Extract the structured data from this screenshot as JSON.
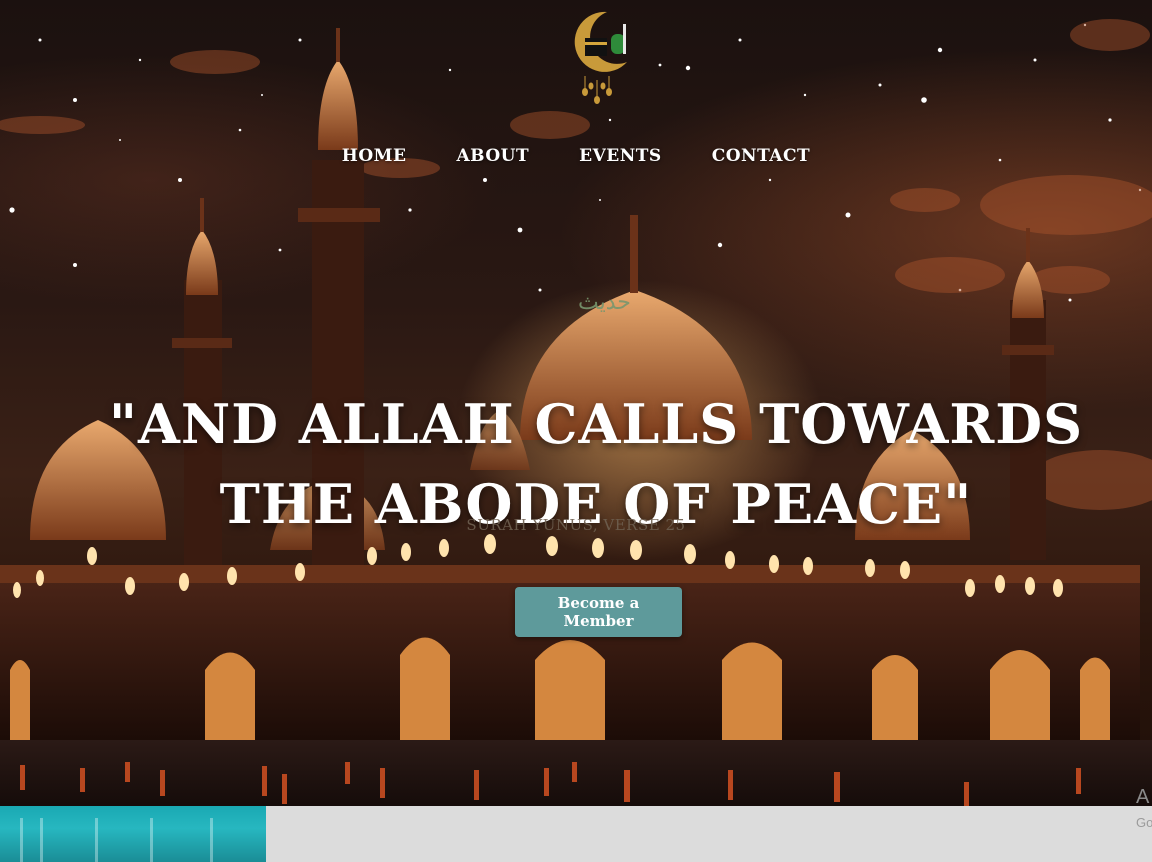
{
  "nav": {
    "items": [
      {
        "label": "Home"
      },
      {
        "label": "About"
      },
      {
        "label": "Events"
      },
      {
        "label": "Contact"
      }
    ]
  },
  "hero": {
    "quote": "\"And Allah calls towards the Abode of Peace\"",
    "citation": "Surah Yunus, Verse 25",
    "cta_label": "Become a Member",
    "arabic_mark": "حديث"
  },
  "colors": {
    "cta_background": "#5e9a9b",
    "teal_strip": "#1aa9b3",
    "grey_strip": "#dcdcdc"
  },
  "side_peek": {
    "line1": "A",
    "line2": "Go"
  },
  "icons": {
    "logo": "crescent-moon-kaaba-logo"
  }
}
